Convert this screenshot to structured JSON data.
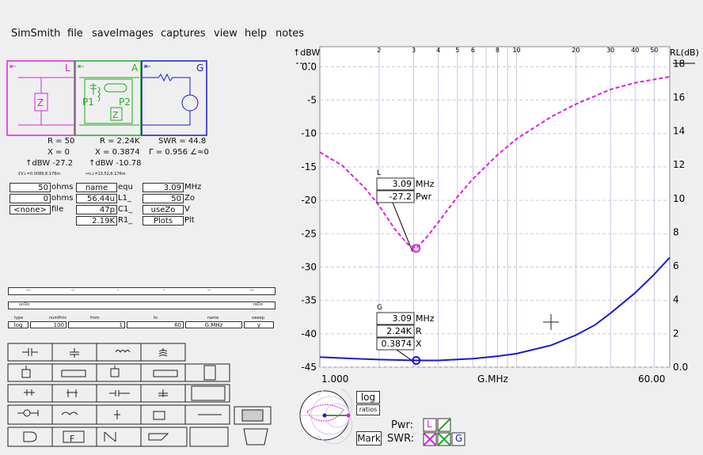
{
  "menu": [
    "SimSmith",
    "file",
    "saveImages",
    "captures",
    "view",
    "help",
    "notes"
  ],
  "blocks": {
    "L": {
      "label": "L",
      "readouts": [
        "R = 50",
        "X = 0",
        "↑dBW -27.2"
      ],
      "tiny": "↕V↓=0.0089,6.176m"
    },
    "A": {
      "label": "A",
      "readouts": [
        "R = 2.24K",
        "X = 0.3874",
        "↑dBW -10.78"
      ],
      "tiny": "↔v↓=13.52,6.176m",
      "p1": "P1",
      "p2": "P2"
    },
    "G": {
      "label": "G",
      "readouts": [
        "SWR = 44.8",
        "Γ = 0.956 ∠≈0"
      ]
    }
  },
  "load_params": [
    {
      "value": "50",
      "unit": "ohms"
    },
    {
      "value": "0",
      "unit": "ohms"
    },
    {
      "value": "<none>",
      "unit": "file"
    }
  ],
  "component_params": [
    {
      "value": "name",
      "unit": "equ"
    },
    {
      "value": "56.44u",
      "unit": "L1_"
    },
    {
      "value": "47p",
      "unit": "C1_"
    },
    {
      "value": "2.19K",
      "unit": "R1_"
    }
  ],
  "gen_params": [
    {
      "value": "3.09",
      "unit": "MHz"
    },
    {
      "value": "50",
      "unit": "Zo"
    },
    {
      "value": "useZo",
      "unit": "V"
    },
    {
      "value": "Plots",
      "unit": "Plt"
    }
  ],
  "nav_buttons": [
    "‹‹‹",
    "‹‹",
    "‹",
    "›",
    "››",
    "›››"
  ],
  "undo": {
    "undo": "unDo",
    "redo": "reDo"
  },
  "sweep": {
    "headers": [
      "type",
      "numPnts",
      "from",
      "to",
      "name",
      "sweep"
    ],
    "values": [
      "log",
      "100",
      "1",
      "60",
      "G.MHz",
      "y"
    ]
  },
  "chart_data": {
    "type": "line",
    "x_label": "G.MHz",
    "x_start": "1.000",
    "x_end": "60.00",
    "x_scale": "log",
    "x_range": [
      1,
      60
    ],
    "top_ticks": [
      "2",
      "3",
      "4",
      "5",
      "6",
      "8",
      "10",
      "20",
      "30",
      "40",
      "50"
    ],
    "top_tick_values": [
      2,
      3,
      4,
      5,
      6,
      8,
      10,
      20,
      30,
      40,
      50
    ],
    "left_title": "↑dBW",
    "right_title": "RL(dB)",
    "y_left_range": [
      -45,
      3
    ],
    "y_left_ticks": [
      "0.0",
      "-5",
      "-10",
      "-15",
      "-20",
      "-25",
      "-30",
      "-35",
      "-40",
      "-45"
    ],
    "y_left_values": [
      0,
      -5,
      -10,
      -15,
      -20,
      -25,
      -30,
      -35,
      -40,
      -45
    ],
    "y_right_range": [
      0,
      19
    ],
    "y_right_ticks": [
      "18",
      "16",
      "14",
      "12",
      "10",
      "8",
      "6",
      "4",
      "2",
      "0.0"
    ],
    "y_right_values": [
      18,
      16,
      14,
      12,
      10,
      8,
      6,
      4,
      2,
      0
    ],
    "series": [
      {
        "name": "L",
        "axis": "left",
        "color": "#e020e0",
        "dash": true,
        "x": [
          1,
          1.3,
          1.7,
          2,
          2.4,
          2.8,
          3.09,
          3.5,
          4,
          5,
          6,
          8,
          10,
          15,
          20,
          30,
          40,
          60
        ],
        "y": [
          -12.8,
          -14.8,
          -18.2,
          -20.8,
          -24.3,
          -26.6,
          -27.2,
          -25.5,
          -23.3,
          -19.5,
          -16.8,
          -13.2,
          -10.8,
          -7.5,
          -5.6,
          -3.4,
          -2.4,
          -1.5
        ]
      },
      {
        "name": "G",
        "axis": "right",
        "color": "#1a1acc",
        "dash": false,
        "x": [
          1,
          1.5,
          2,
          3.09,
          4,
          6,
          8,
          10,
          15,
          20,
          25,
          30,
          40,
          50,
          60
        ],
        "y": [
          0.6,
          0.5,
          0.45,
          0.4,
          0.4,
          0.5,
          0.65,
          0.8,
          1.3,
          1.9,
          2.5,
          3.2,
          4.4,
          5.5,
          6.5
        ]
      }
    ],
    "markers": [
      {
        "name": "L",
        "freq": "3.09",
        "freq_unit": "MHz",
        "value": "-27.2",
        "value_unit": "Pwr"
      },
      {
        "name": "G",
        "freq": "3.09",
        "freq_unit": "MHz",
        "r": "2.24K",
        "r_unit": "R",
        "x": "0.3874",
        "x_unit": "X"
      }
    ]
  },
  "controls": {
    "log": "log",
    "ratios": "ratios",
    "mark": "Mark",
    "pwr": "Pwr:",
    "swr": "SWR:",
    "pwr_L": "L",
    "swr_G": "G"
  },
  "colors": {
    "magenta": "#e020e0",
    "green": "#22aa22",
    "blue": "#1a1acc"
  }
}
